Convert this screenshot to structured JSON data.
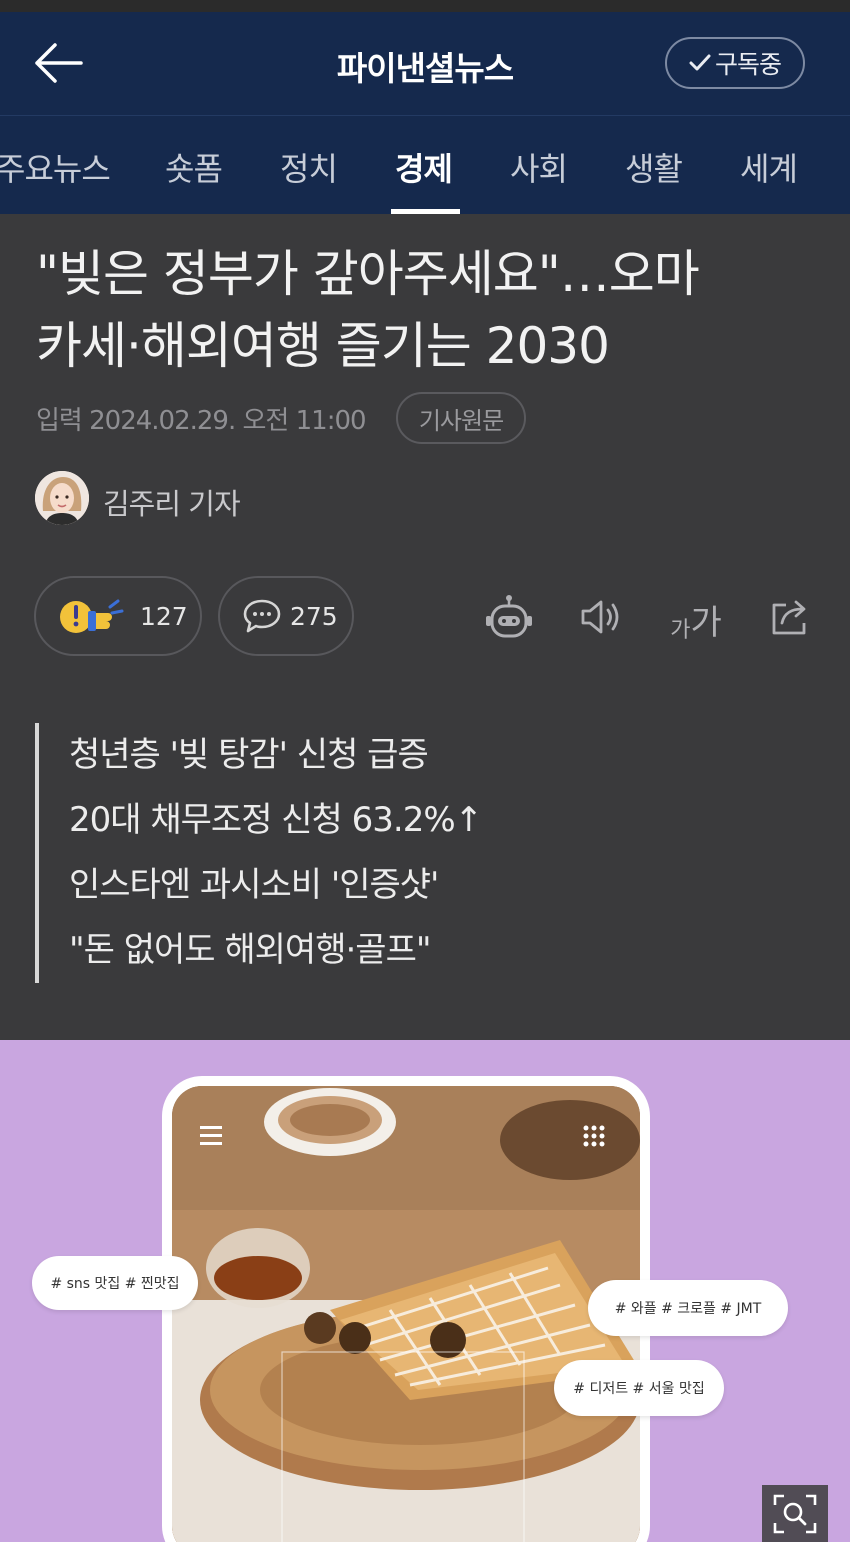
{
  "header": {
    "title": "파이낸셜뉴스",
    "subscribe_label": "구독중"
  },
  "tabs": [
    {
      "label": "주요뉴스",
      "active": false
    },
    {
      "label": "숏폼",
      "active": false
    },
    {
      "label": "정치",
      "active": false
    },
    {
      "label": "경제",
      "active": true
    },
    {
      "label": "사회",
      "active": false
    },
    {
      "label": "생활",
      "active": false
    },
    {
      "label": "세계",
      "active": false
    }
  ],
  "article": {
    "headline_line1": "\"빚은 정부가 갚아주세요\"…오마",
    "headline_line2": "카세·해외여행 즐기는 2030",
    "published": "입력 2024.02.29. 오전 11:00",
    "original_link_label": "기사원문",
    "reporter": "김주리 기자",
    "reaction_count": "127",
    "comment_count": "275",
    "font_size_label_small": "가",
    "font_size_label_big": "가",
    "summary": [
      "청년층 '빚 탕감' 신청 급증",
      "20대 채무조정 신청 63.2%↑",
      "인스타엔 과시소비 '인증샷'",
      "\"돈 없어도 해외여행·골프\""
    ]
  },
  "image": {
    "tags": [
      "# sns 맛집 # 찐맛집",
      "# 와플 # 크로플 # JMT",
      "# 디저트 # 서울 맛집"
    ]
  },
  "colors": {
    "header_bg": "#15294d",
    "page_bg": "#3a3a3c",
    "photo_bg": "#c9a6e0"
  }
}
